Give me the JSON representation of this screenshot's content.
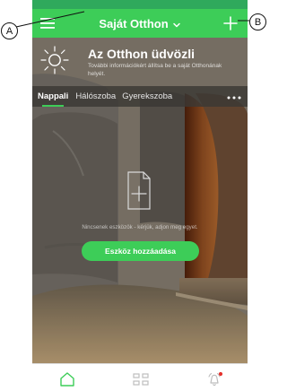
{
  "header": {
    "title": "Saját Otthon",
    "menu_icon": "hamburger-menu-icon",
    "add_icon": "plus-icon",
    "title_icon": "chevron-down-icon"
  },
  "welcome": {
    "title": "Az Otthon üdvözli",
    "subtitle": "További információkért állítsa be a saját Otthonának helyét.",
    "icon": "sun-icon"
  },
  "tabs": [
    {
      "label": "Nappali",
      "active": true
    },
    {
      "label": "Hálószoba",
      "active": false
    },
    {
      "label": "Gyerekszoba",
      "active": false
    }
  ],
  "more_icon": "more-horizontal-icon",
  "empty_state": {
    "icon": "add-document-icon",
    "text": "Nincsenek eszközök - kérjük, adjon meg egyet."
  },
  "actions": {
    "add_device": "Eszköz hozzáadása"
  },
  "bottom_nav": {
    "items": [
      {
        "icon": "home-icon",
        "active": true
      },
      {
        "icon": "devices-grid-icon",
        "active": false
      },
      {
        "icon": "alarm-bell-icon",
        "notification": true
      }
    ]
  },
  "callouts": {
    "a": "A",
    "b": "B"
  },
  "colors": {
    "accent": "#3dcd58",
    "statusbar": "#2fa95c",
    "tabbar": "#3a3834",
    "notification": "#e5322d"
  }
}
